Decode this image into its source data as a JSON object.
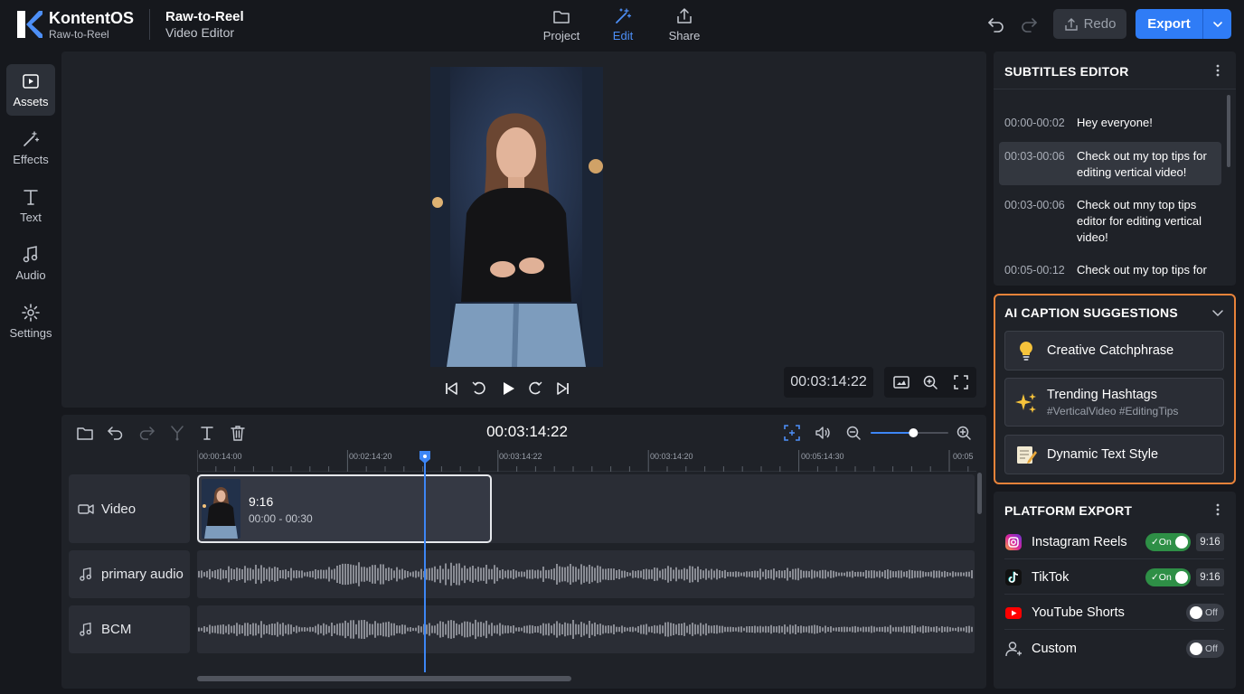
{
  "app": {
    "name": "KontentOS",
    "tagline": "Raw-to-Reel"
  },
  "project": {
    "title": "Raw-to-Reel",
    "subtitle": "Video Editor"
  },
  "mode_tabs": [
    {
      "label": "Project",
      "icon": "folder-icon"
    },
    {
      "label": "Edit",
      "icon": "magic-wand-icon",
      "active": true
    },
    {
      "label": "Share",
      "icon": "share-icon"
    }
  ],
  "header_actions": {
    "redo_label": "Redo",
    "export_label": "Export"
  },
  "left_nav": [
    {
      "label": "Assets",
      "icon": "play-box-icon",
      "active": true
    },
    {
      "label": "Effects",
      "icon": "wand-sparkle-icon"
    },
    {
      "label": "Text",
      "icon": "text-t-icon"
    },
    {
      "label": "Audio",
      "icon": "music-note-icon"
    },
    {
      "label": "Settings",
      "icon": "gear-icon"
    }
  ],
  "preview": {
    "timecode": "00:03:14:22"
  },
  "timeline": {
    "timecode": "00:03:14:22",
    "ruler_labels": [
      "00:00:14:00",
      "00:02:14:20",
      "00:03:14:22",
      "00:03:14:20",
      "00:05:14:30",
      "00:05"
    ],
    "zoom_level": 0.55,
    "tracks": [
      {
        "label": "Video",
        "icon": "video-camera-icon"
      },
      {
        "label": "primary audio",
        "icon": "music-note-icon"
      },
      {
        "label": "BCM",
        "icon": "music-note-icon"
      }
    ],
    "clip": {
      "title": "9:16",
      "range": "00:00 - 00:30"
    }
  },
  "subtitles": {
    "title": "SUBTITLES EDITOR",
    "rows": [
      {
        "time": "00:00-00:02",
        "text": "Hey everyone!"
      },
      {
        "time": "00:03-00:06",
        "text": "Check out my top tips for editing vertical video!",
        "selected": true
      },
      {
        "time": "00:03-00:06",
        "text": "Check out mny top tips editor for editing vertical video!"
      },
      {
        "time": "00:05-00:12",
        "text": "Check out my top tips for"
      }
    ]
  },
  "ai_captions": {
    "title": "AI CAPTION SUGGESTIONS",
    "items": [
      {
        "label": "Creative Catchphrase",
        "icon": "lightbulb-icon"
      },
      {
        "label": "Trending Hashtags",
        "sub": "#VerticalVideo #EditingTips",
        "icon": "sparkles-icon"
      },
      {
        "label": "Dynamic Text Style",
        "icon": "notepad-pencil-icon"
      }
    ]
  },
  "platform_export": {
    "title": "PLATFORM EXPORT",
    "rows": [
      {
        "name": "Instagram Reels",
        "icon": "instagram-icon",
        "toggle": "On",
        "ratio": "9:16"
      },
      {
        "name": "TikTok",
        "icon": "tiktok-icon",
        "toggle": "On",
        "ratio": "9:16"
      },
      {
        "name": "YouTube Shorts",
        "icon": "youtube-icon",
        "toggle": "Off"
      },
      {
        "name": "Custom",
        "icon": "user-icon",
        "toggle": "Off"
      }
    ]
  },
  "colors": {
    "accent": "#2f7cf6",
    "toggle_on": "#2e8f46",
    "highlight_border": "#e8833a"
  }
}
